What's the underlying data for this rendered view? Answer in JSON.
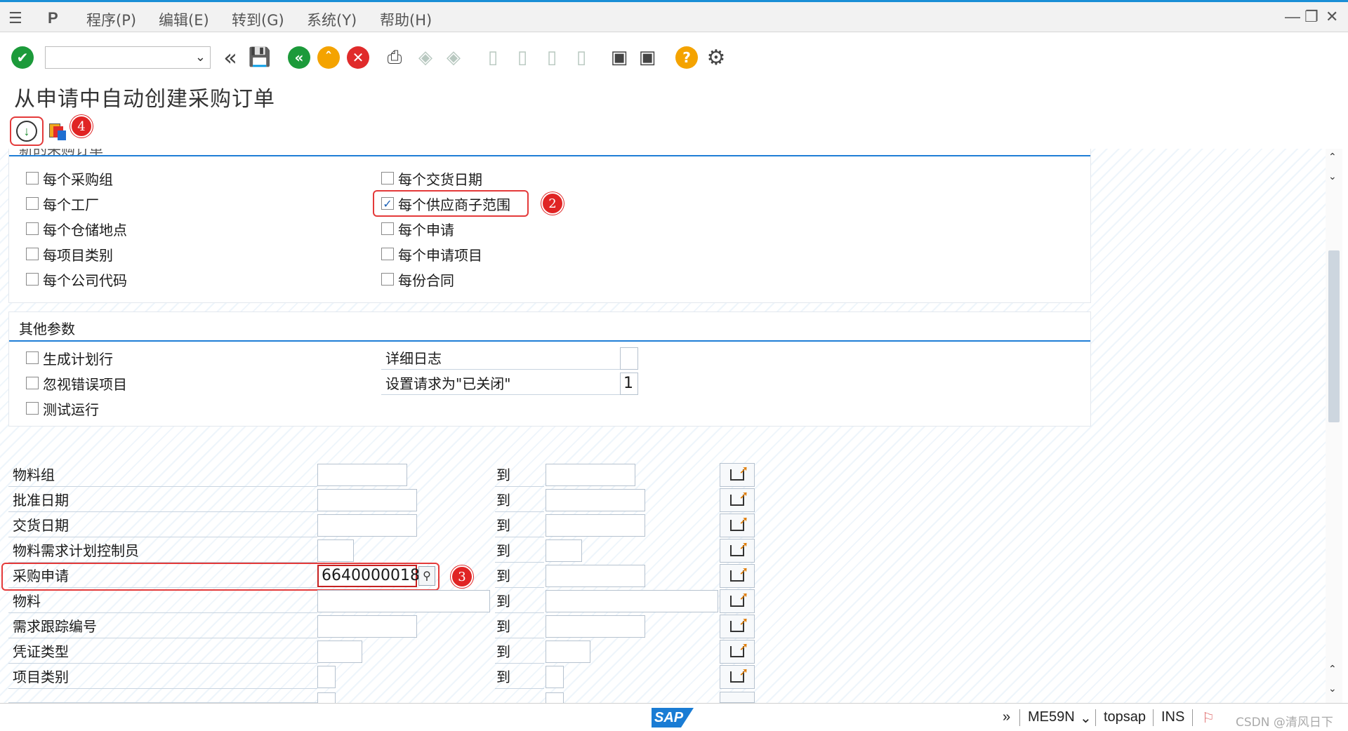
{
  "menu": {
    "items": [
      "程序(P)",
      "编辑(E)",
      "转到(G)",
      "系统(Y)",
      "帮助(H)"
    ]
  },
  "toolbar": {
    "command_value": ""
  },
  "page_title": "从申请中自动创建采购订单",
  "badges": [
    "2",
    "3",
    "4"
  ],
  "split_group": {
    "title_partial": "新的采购订单",
    "left": [
      {
        "label": "每个采购组",
        "checked": false
      },
      {
        "label": "每个工厂",
        "checked": false
      },
      {
        "label": "每个仓储地点",
        "checked": false
      },
      {
        "label": "每项目类别",
        "checked": false
      },
      {
        "label": "每个公司代码",
        "checked": false
      }
    ],
    "right": [
      {
        "label": "每个交货日期",
        "checked": false
      },
      {
        "label": "每个供应商子范围",
        "checked": true
      },
      {
        "label": "每个申请",
        "checked": false
      },
      {
        "label": "每个申请项目",
        "checked": false
      },
      {
        "label": "每份合同",
        "checked": false
      }
    ]
  },
  "other_params": {
    "title": "其他参数",
    "checkboxes": [
      {
        "label": "生成计划行",
        "checked": false
      },
      {
        "label": "忽视错误项目",
        "checked": false
      },
      {
        "label": "测试运行",
        "checked": false
      }
    ],
    "fields": [
      {
        "label": "详细日志",
        "value": ""
      },
      {
        "label": "设置请求为\"已关闭\"",
        "value": "1"
      }
    ]
  },
  "selection": {
    "to_label": "到",
    "rows": [
      {
        "label": "物料组",
        "from": "",
        "to": ""
      },
      {
        "label": "批准日期",
        "from": "",
        "to": ""
      },
      {
        "label": "交货日期",
        "from": "",
        "to": ""
      },
      {
        "label": "物料需求计划控制员",
        "from": "",
        "to": ""
      },
      {
        "label": "采购申请",
        "from": "6640000018",
        "to": ""
      },
      {
        "label": "物料",
        "from": "",
        "to": ""
      },
      {
        "label": "需求跟踪编号",
        "from": "",
        "to": ""
      },
      {
        "label": "凭证类型",
        "from": "",
        "to": ""
      },
      {
        "label": "项目类别",
        "from": "",
        "to": ""
      }
    ]
  },
  "status": {
    "logo": "SAP",
    "transaction": "ME59N",
    "server": "topsap",
    "mode": "INS",
    "watermark": "CSDN @清风日下"
  }
}
